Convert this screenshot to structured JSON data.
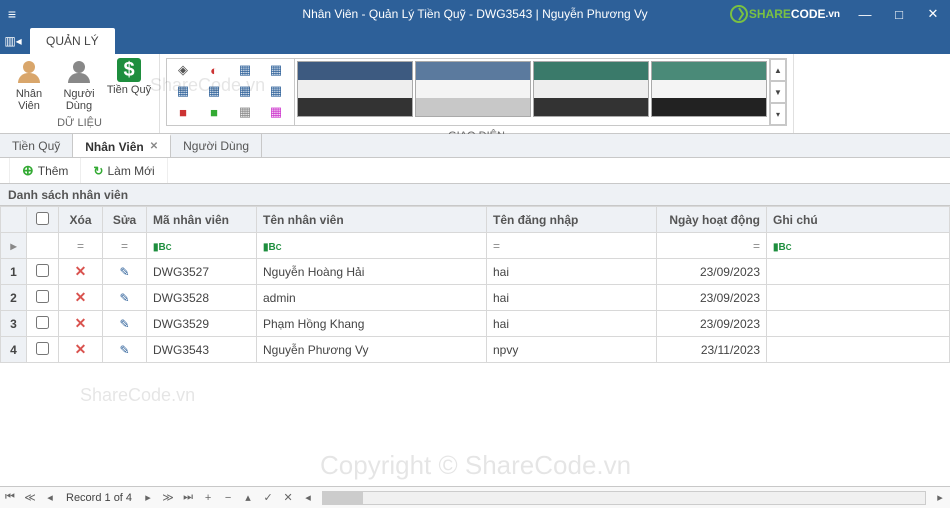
{
  "titlebar": {
    "title": "Nhân Viên - Quản Lý Tiền Quỹ - DWG3543 | Nguyễn Phương Vy",
    "logo_share": "SHARE",
    "logo_code": "CODE",
    "logo_tld": ".vn"
  },
  "ribbon": {
    "tab": "QUẢN LÝ",
    "group_data": "DỮ LIỆU",
    "group_ui": "GIAO DIỆN",
    "btn_nhanvien": "Nhân Viên",
    "btn_nguoidung": "Người Dùng",
    "btn_tienquy": "Tiền Quỹ"
  },
  "doctabs": {
    "t0": "Tiền Quỹ",
    "t1": "Nhân Viên",
    "t2": "Người Dùng"
  },
  "toolbar": {
    "add": "Thêm",
    "refresh": "Làm Mới"
  },
  "panel": {
    "title": "Danh sách nhân viên"
  },
  "cols": {
    "xoa": "Xóa",
    "sua": "Sửa",
    "ma": "Mã nhân viên",
    "ten": "Tên nhân viên",
    "dangnhap": "Tên đăng nhập",
    "ngay": "Ngày hoạt động",
    "ghichu": "Ghi chú"
  },
  "rows": [
    {
      "n": "1",
      "ma": "DWG3527",
      "ten": "Nguyễn Hoàng Hải",
      "dn": "hai",
      "ngay": "23/09/2023",
      "gc": ""
    },
    {
      "n": "2",
      "ma": "DWG3528",
      "ten": "admin",
      "dn": "hai",
      "ngay": "23/09/2023",
      "gc": ""
    },
    {
      "n": "3",
      "ma": "DWG3529",
      "ten": "Phạm Hồng Khang",
      "dn": "hai",
      "ngay": "23/09/2023",
      "gc": ""
    },
    {
      "n": "4",
      "ma": "DWG3543",
      "ten": "Nguyễn Phương Vy",
      "dn": "npvy",
      "ngay": "23/11/2023",
      "gc": ""
    }
  ],
  "nav": {
    "record": "Record 1 of 4"
  },
  "watermarks": {
    "w1": "ShareCode.vn",
    "w2": "ShareCode.vn",
    "w3": "Copyright © ShareCode.vn"
  }
}
